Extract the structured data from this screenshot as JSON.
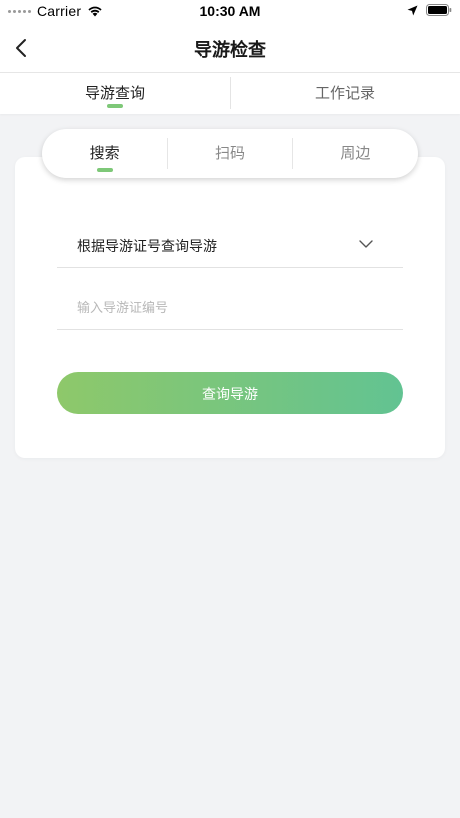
{
  "status_bar": {
    "carrier": "Carrier",
    "time": "10:30 AM"
  },
  "nav": {
    "title": "导游检查"
  },
  "main_tabs": [
    {
      "label": "导游查询",
      "active": true
    },
    {
      "label": "工作记录",
      "active": false
    }
  ],
  "sub_tabs": [
    {
      "label": "搜索",
      "active": true
    },
    {
      "label": "扫码",
      "active": false
    },
    {
      "label": "周边",
      "active": false
    }
  ],
  "form": {
    "select_value": "根据导游证号查询导游",
    "input_placeholder": "输入导游证编号",
    "input_value": "",
    "submit_label": "查询导游"
  },
  "colors": {
    "accent": "#7ec878",
    "button_gradient_start": "#8ec86a",
    "button_gradient_end": "#62c392",
    "background": "#f2f3f5"
  },
  "icons": {
    "back": "chevron-left-icon",
    "dropdown": "chevron-down-icon",
    "wifi": "wifi-icon",
    "location": "location-arrow-icon",
    "battery": "battery-icon"
  }
}
